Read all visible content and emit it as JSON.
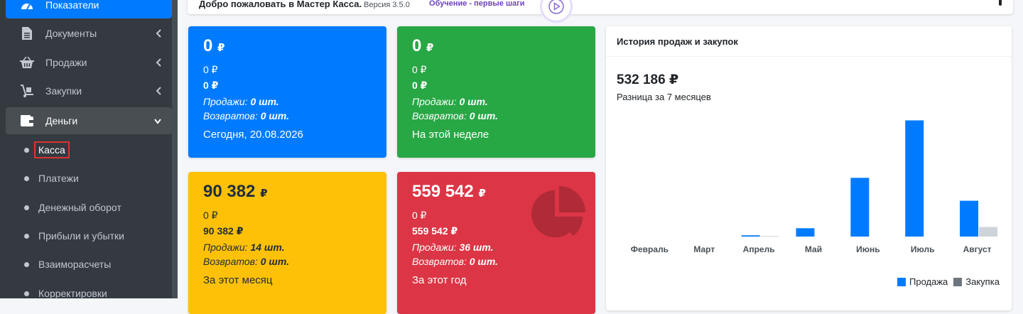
{
  "sidebar": {
    "top_item": "Показатели",
    "items": [
      {
        "label": "Документы"
      },
      {
        "label": "Продажи"
      },
      {
        "label": "Закупки"
      },
      {
        "label": "Деньги"
      }
    ],
    "money_sub": [
      "Касса",
      "Платежи",
      "Денежный оборот",
      "Прибыли и убытки",
      "Взаиморасчеты",
      "Корректировки"
    ]
  },
  "header": {
    "title": "Добро пожаловать в Мастер Касса.",
    "version": "Версия 3.5.0",
    "link": "Обучение - первые шаги"
  },
  "boxes": {
    "today": {
      "main": "0",
      "currency": "₽",
      "line1": "0 ₽",
      "line2": "0 ₽",
      "sales_label": "Продажи:",
      "sales_value": "0 шт.",
      "returns_label": "Возвратов:",
      "returns_value": "0 шт.",
      "period": "Сегодня, 20.08.2026"
    },
    "week": {
      "main": "0",
      "currency": "₽",
      "line1": "0 ₽",
      "line2": "0 ₽",
      "sales_label": "Продажи:",
      "sales_value": "0 шт.",
      "returns_label": "Возвратов:",
      "returns_value": "0 шт.",
      "period": "На этой неделе"
    },
    "month": {
      "main": "90 382",
      "currency": "₽",
      "line1": "0 ₽",
      "line2": "90 382 ₽",
      "sales_label": "Продажи:",
      "sales_value": "14 шт.",
      "returns_label": "Возвратов:",
      "returns_value": "0 шт.",
      "period": "За этот месяц"
    },
    "year": {
      "main": "559 542",
      "currency": "₽",
      "line1": "0 ₽",
      "line2": "559 542 ₽",
      "sales_label": "Продажи:",
      "sales_value": "36 шт.",
      "returns_label": "Возвратов:",
      "returns_value": "0 шт.",
      "period": "За этот год"
    }
  },
  "chart_panel": {
    "title": "История продаж и закупок",
    "total": "532 186 ₽",
    "caption": "Разница за 7 месяцев"
  },
  "chart_data": {
    "type": "bar",
    "categories": [
      "Февраль",
      "Март",
      "Апрель",
      "Май",
      "Июнь",
      "Июль",
      "Август"
    ],
    "series": [
      {
        "name": "Продажа",
        "color": "#007bff",
        "values": [
          0,
          0,
          3000,
          20000,
          141000,
          279000,
          86000
        ]
      },
      {
        "name": "Закупка",
        "color": "#ced4da",
        "values": [
          0,
          0,
          1500,
          0,
          0,
          0,
          23000
        ]
      }
    ],
    "ylim": [
      0,
      290000
    ],
    "grid": false,
    "legend": "bottom-right"
  },
  "colors": {
    "sidebar_bg": "#343a40",
    "primary": "#007bff",
    "success": "#28a745",
    "warning": "#ffc107",
    "danger": "#dc3545"
  }
}
